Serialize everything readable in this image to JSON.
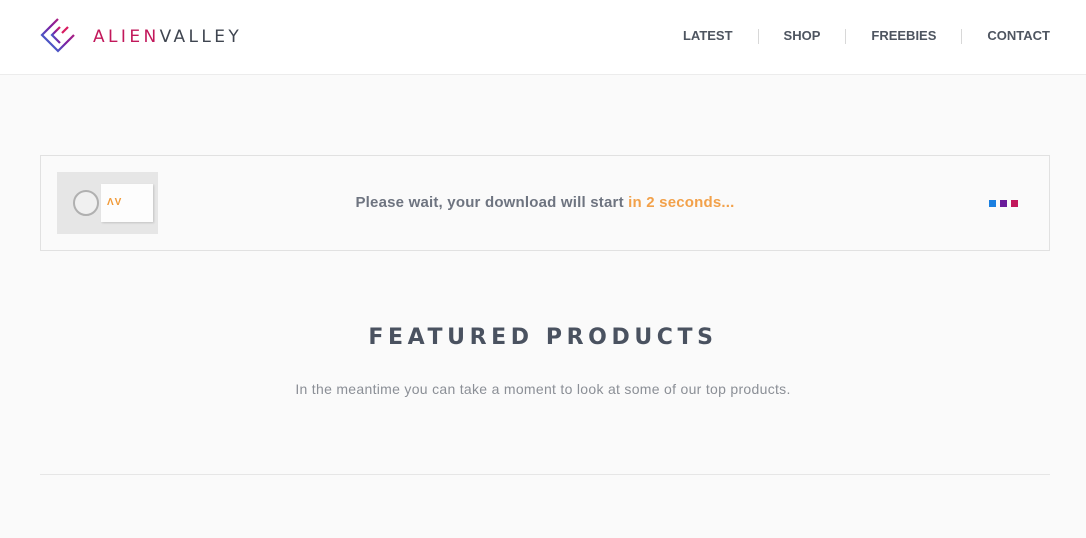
{
  "brand": {
    "name_part1": "ALIEN",
    "name_part2": "VALLEY",
    "icon": "alienvalley-logo-icon"
  },
  "nav": {
    "items": [
      {
        "label": "LATEST"
      },
      {
        "label": "SHOP"
      },
      {
        "label": "FREEBIES"
      },
      {
        "label": "CONTACT"
      }
    ]
  },
  "download": {
    "thumbnail_label": "ΛV",
    "message_prefix": "Please wait, your download will start ",
    "message_highlight": "in 2 seconds...",
    "loader_colors": [
      "#1a7fe0",
      "#6a1b9a",
      "#c2185b"
    ]
  },
  "featured": {
    "title": "FEATURED PRODUCTS",
    "subtitle": "In the meantime you can take a moment to look at some of our top products."
  },
  "colors": {
    "accent": "#f2a14a",
    "brand": "#c2185b",
    "text": "#4e5560"
  }
}
